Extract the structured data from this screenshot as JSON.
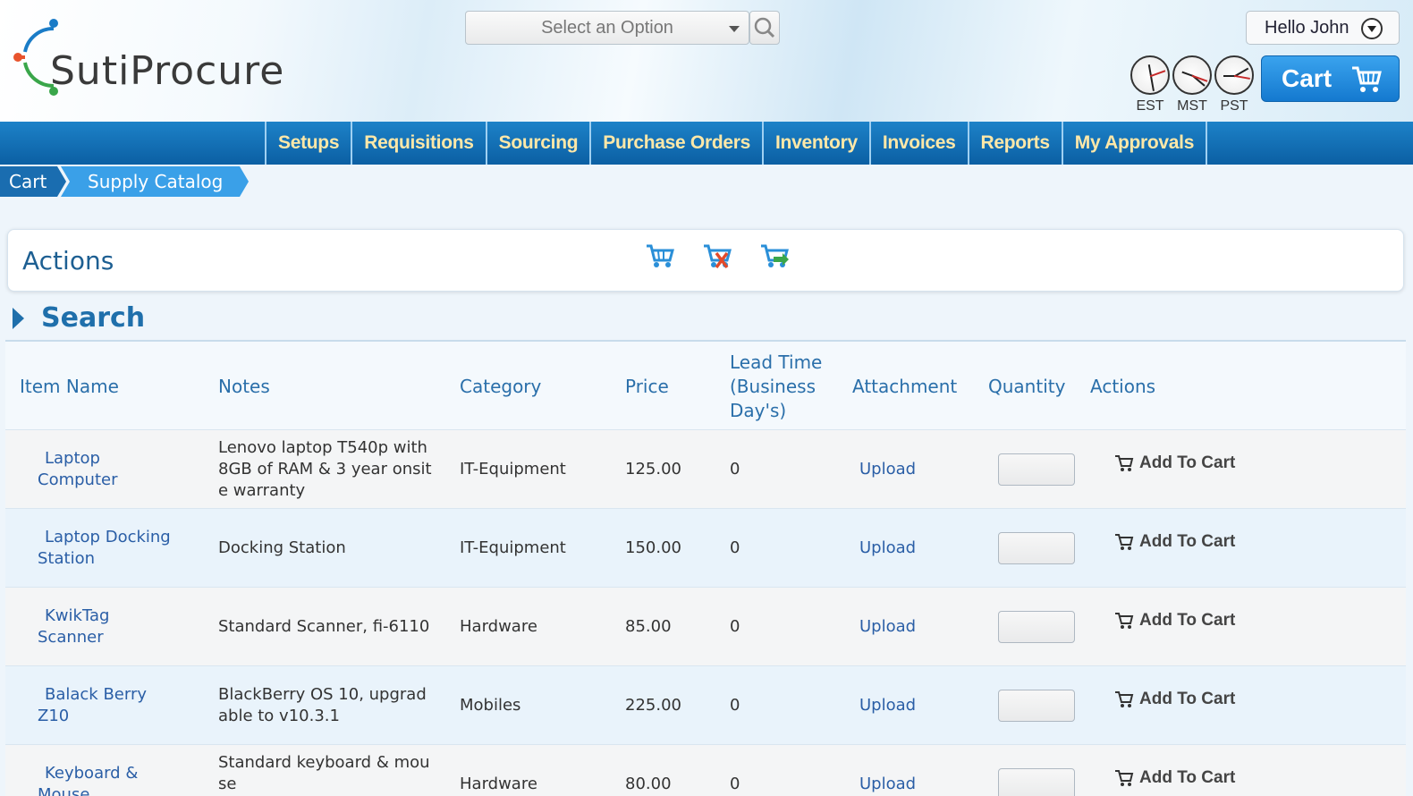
{
  "header": {
    "logo_text": "SutiProcure",
    "select_placeholder": "Select an Option",
    "greeting": "Hello John",
    "cart_label": "Cart",
    "clocks": [
      {
        "label": "EST"
      },
      {
        "label": "MST"
      },
      {
        "label": "PST"
      }
    ]
  },
  "nav": {
    "items": [
      "Setups",
      "Requisitions",
      "Sourcing",
      "Purchase Orders",
      "Inventory",
      "Invoices",
      "Reports",
      "My Approvals"
    ]
  },
  "breadcrumb": {
    "items": [
      "Cart",
      "Supply Catalog"
    ]
  },
  "actions": {
    "title": "Actions",
    "icons": [
      "add-to-cart-icon",
      "remove-from-cart-icon",
      "checkout-cart-icon"
    ]
  },
  "search": {
    "title": "Search"
  },
  "table": {
    "headers": {
      "item_name": "Item Name",
      "notes": "Notes",
      "category": "Category",
      "price": "Price",
      "lead_time_1": "Lead Time",
      "lead_time_2": "(Business",
      "lead_time_3": "Day's)",
      "attachment": "Attachment",
      "quantity": "Quantity",
      "actions": "Actions"
    },
    "rows": [
      {
        "name1": "Laptop",
        "name2": "Computer",
        "notes1": "Lenovo laptop T540p with",
        "notes2": "8GB of RAM & 3 year onsit",
        "notes3": "e warranty",
        "category": "IT-Equipment",
        "price": "125.00",
        "lead": "0",
        "attachment": "Upload",
        "action": "Add To Cart"
      },
      {
        "name1": "Laptop Docking",
        "name2": "Station",
        "notes1": "Docking Station",
        "notes2": "",
        "notes3": "",
        "category": "IT-Equipment",
        "price": "150.00",
        "lead": "0",
        "attachment": "Upload",
        "action": "Add To Cart"
      },
      {
        "name1": "KwikTag",
        "name2": "Scanner",
        "notes1": "Standard Scanner, fi-6110",
        "notes2": "",
        "notes3": "",
        "category": "Hardware",
        "price": "85.00",
        "lead": "0",
        "attachment": "Upload",
        "action": "Add To Cart"
      },
      {
        "name1": "Balack Berry",
        "name2": "Z10",
        "notes1": "BlackBerry OS 10, upgrad",
        "notes2": "able to v10.3.1",
        "notes3": "",
        "category": "Mobiles",
        "price": "225.00",
        "lead": "0",
        "attachment": "Upload",
        "action": "Add To Cart"
      },
      {
        "name1": "Keyboard &",
        "name2": "Mouse",
        "notes1": "Standard keyboard & mou",
        "notes2": "se",
        "notes3": "",
        "category": "Hardware",
        "price": "80.00",
        "lead": "0",
        "attachment": "Upload",
        "action": "Add To Cart"
      }
    ]
  },
  "colors": {
    "nav_bg": "#0b5fa3",
    "nav_text": "#ffe8a8",
    "link": "#2a5ea6",
    "cart_button": "#1479cf"
  }
}
